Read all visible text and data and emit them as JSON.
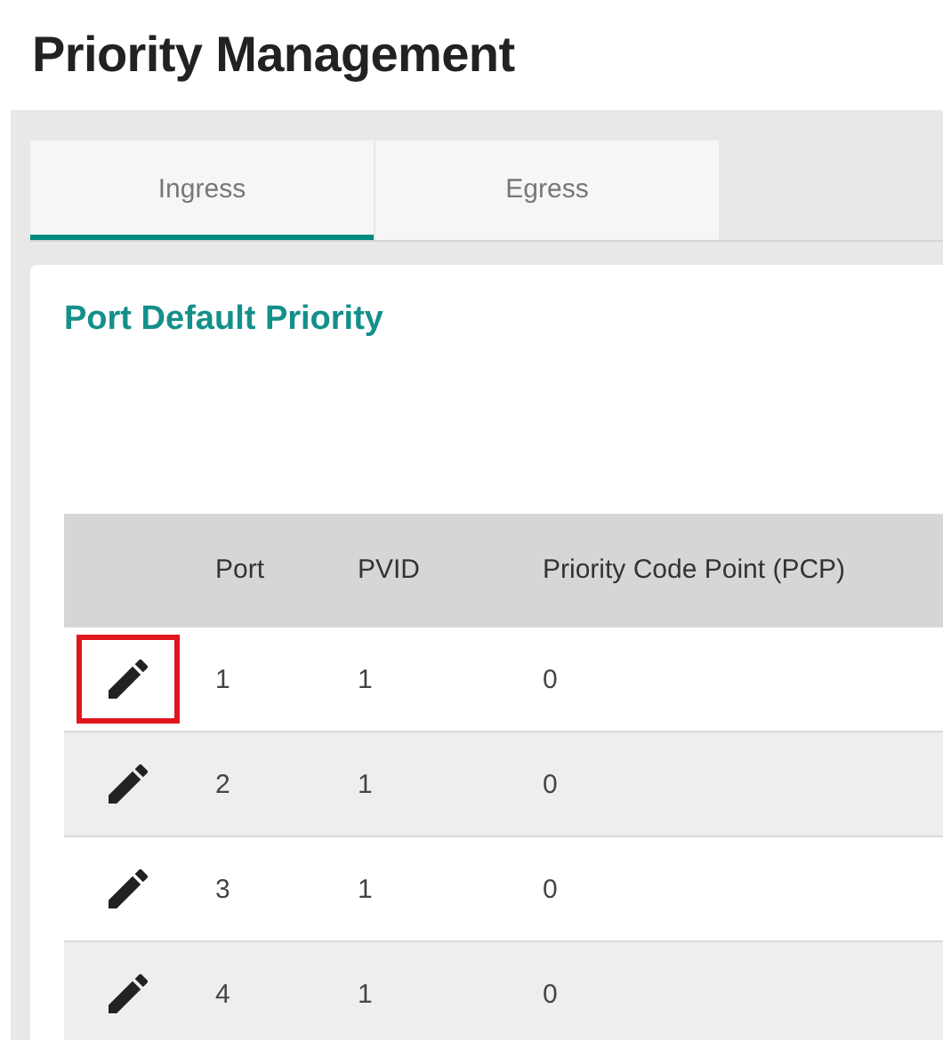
{
  "page": {
    "title": "Priority Management"
  },
  "tabs": [
    {
      "label": "Ingress",
      "selected": true
    },
    {
      "label": "Egress",
      "selected": false
    }
  ],
  "card": {
    "title": "Port Default Priority",
    "table": {
      "columns": [
        "Port",
        "PVID",
        "Priority Code Point (PCP)"
      ],
      "rows": [
        {
          "cells": [
            "1",
            "1",
            "0"
          ],
          "highlighted": true
        },
        {
          "cells": [
            "2",
            "1",
            "0"
          ],
          "highlighted": false
        },
        {
          "cells": [
            "3",
            "1",
            "0"
          ],
          "highlighted": false
        },
        {
          "cells": [
            "4",
            "1",
            "0"
          ],
          "highlighted": false
        }
      ]
    }
  }
}
